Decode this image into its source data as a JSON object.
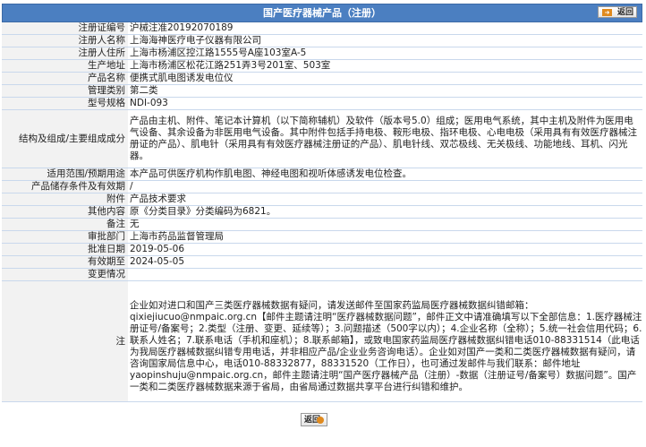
{
  "header": {
    "title": "国产医疗器械产品（注册）",
    "back_label": "返回"
  },
  "rows": [
    {
      "label": "注册证编号",
      "value": "沪械注准20192070189"
    },
    {
      "label": "注册人名称",
      "value": "上海海神医疗电子仪器有限公司"
    },
    {
      "label": "注册人住所",
      "value": "上海市杨浦区控江路1555号A座103室A-5"
    },
    {
      "label": "生产地址",
      "value": "上海市杨浦区松花江路251弄3号201室、503室"
    },
    {
      "label": "产品名称",
      "value": "便携式肌电图诱发电位仪"
    },
    {
      "label": "管理类别",
      "value": "第二类"
    },
    {
      "label": "型号规格",
      "value": "NDI-093"
    },
    {
      "label": "结构及组成/主要组成成分",
      "value": "产品由主机、附件、笔记本计算机（以下简称辅机）及软件（版本号5.0）组成；医用电气系统，其中主机及附件为医用电气设备、其余设备为非医用电气设备。其中附件包括手持电极、鞍形电极、指环电极、心电电极（采用具有有效医疗器械注册证的产品）、肌电针（采用具有有效医疗器械注册证的产品）、肌电针线、双芯极线、无关极线、功能地线、耳机、闪光器。"
    },
    {
      "label": "适用范围/预期用途",
      "value": "本产品可供医疗机构作肌电图、神经电图和视听体感诱发电位检查。"
    },
    {
      "label": "产品储存条件及有效期",
      "value": "/"
    },
    {
      "label": "附件",
      "value": "产品技术要求"
    },
    {
      "label": "其他内容",
      "value": "原《分类目录》分类编码为6821。"
    },
    {
      "label": "备注",
      "value": "无"
    },
    {
      "label": "审批部门",
      "value": "上海市药品监督管理局"
    },
    {
      "label": "批准日期",
      "value": "2019-05-06"
    },
    {
      "label": "有效期至",
      "value": "2024-05-05"
    },
    {
      "label": "变更情况",
      "value": ""
    },
    {
      "label": "注",
      "value": "企业如对进口和国产三类医疗器械数据有疑问，请发送邮件至国家药监局医疗器械数据纠错邮箱：qixiejiucuo@nmpaic.org.cn【邮件主题请注明“医疗器械数据问题”，邮件正文中请准确填写以下全部信息：1.医疗器械注册证号/备案号；2.类型（注册、变更、延续等）；3.问题描述（500字以内）；4.企业名称（全称）；5.统一社会信用代码；6.联系人姓名；7.联系电话（手机和座机）；8.联系邮箱】，或致电国家药监局医疗器械数据纠错电话010-88331514（此电话为我局医疗器械数据纠错专用电话，并非相应产品/企业业务咨询电话）。企业如对国产一类和二类医疗器械数据有疑问，请咨询国家局信息中心，电话010-88332877，88331520（工作日），也可通过发邮件与我们联系：邮件地址yaopinshuju@nmpaic.org.cn，邮件主题请注明“国产医疗器械产品（注册）-数据（注册证号/备案号）数据问题”。国产一类和二类医疗器械数据来源于省局，由省局通过数据共享平台进行纠错和维护。"
    }
  ],
  "footer": {
    "back_label": "返回"
  },
  "colors": {
    "header_bg": "#4b7fc1",
    "label_bg": "#f2f2f2",
    "row_border": "#c9d8ec",
    "back_arrow": "#e08a1e"
  }
}
